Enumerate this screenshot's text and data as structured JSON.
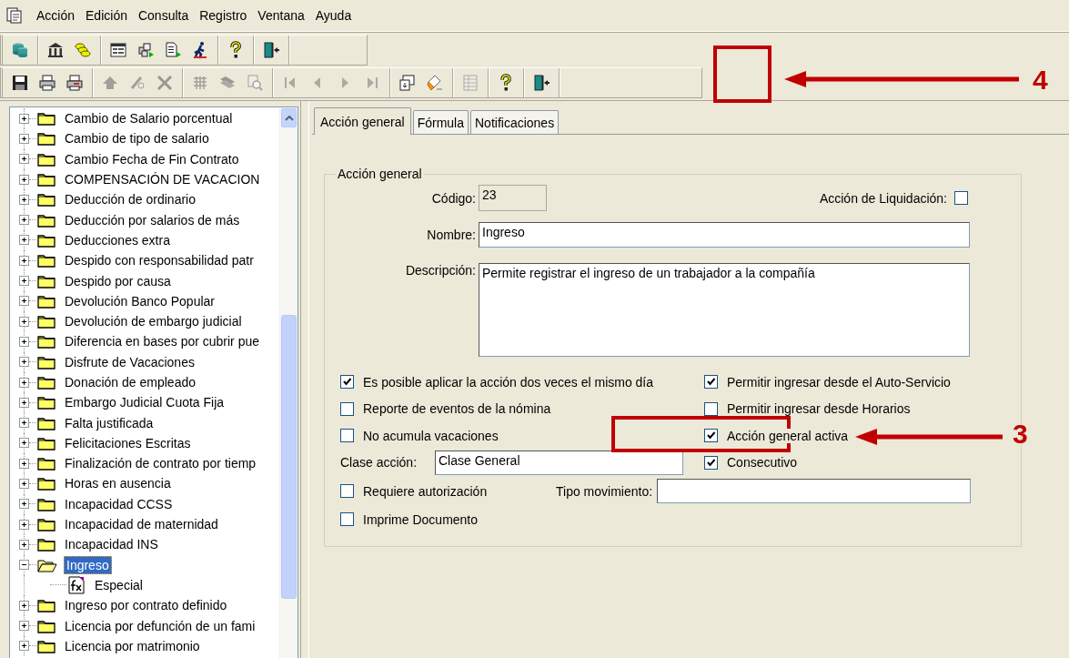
{
  "menu": [
    "Acción",
    "Edición",
    "Consulta",
    "Registro",
    "Ventana",
    "Ayuda"
  ],
  "toolbars": [
    {
      "groups": [
        {
          "buttons": [
            {
              "disabled": false
            }
          ]
        },
        {
          "buttons": [
            {
              "disabled": false
            },
            {
              "disabled": false
            }
          ]
        },
        {
          "buttons": [
            {
              "disabled": false
            },
            {
              "disabled": false
            },
            {
              "disabled": false
            },
            {
              "disabled": false
            }
          ]
        },
        {
          "buttons": [
            {
              "disabled": false
            }
          ]
        },
        {
          "buttons": [
            {
              "disabled": false
            }
          ]
        }
      ]
    },
    {
      "groups": [
        {
          "buttons": [
            {
              "disabled": false
            },
            {
              "disabled": false
            },
            {
              "disabled": false
            }
          ]
        },
        {
          "buttons": [
            {
              "disabled": true
            },
            {
              "disabled": true
            },
            {
              "disabled": true
            }
          ]
        },
        {
          "buttons": [
            {
              "disabled": true
            },
            {
              "disabled": true
            },
            {
              "disabled": true
            }
          ]
        },
        {
          "buttons": [
            {
              "disabled": true
            },
            {
              "disabled": true
            },
            {
              "disabled": true
            },
            {
              "disabled": true
            }
          ]
        },
        {
          "buttons": [
            {
              "disabled": false
            },
            {
              "disabled": false
            }
          ]
        },
        {
          "buttons": [
            {
              "disabled": true
            }
          ]
        },
        {
          "buttons": [
            {
              "disabled": false
            }
          ]
        },
        {
          "buttons": [
            {
              "disabled": false
            }
          ]
        }
      ]
    }
  ],
  "tree": [
    {
      "label": "Cambio de Salario porcentual",
      "expanded": false,
      "selected": false
    },
    {
      "label": "Cambio de tipo de salario",
      "expanded": false,
      "selected": false
    },
    {
      "label": "Cambio Fecha de Fin Contrato",
      "expanded": false,
      "selected": false
    },
    {
      "label": "COMPENSACIÓN DE VACACION",
      "expanded": false,
      "selected": false
    },
    {
      "label": "Deducción de ordinario",
      "expanded": false,
      "selected": false
    },
    {
      "label": "Deducción por salarios de más",
      "expanded": false,
      "selected": false
    },
    {
      "label": "Deducciones extra",
      "expanded": false,
      "selected": false
    },
    {
      "label": "Despido con responsabilidad patr",
      "expanded": false,
      "selected": false
    },
    {
      "label": "Despido por causa",
      "expanded": false,
      "selected": false
    },
    {
      "label": "Devolución Banco Popular",
      "expanded": false,
      "selected": false
    },
    {
      "label": "Devolución de embargo judicial",
      "expanded": false,
      "selected": false
    },
    {
      "label": "Diferencia en bases por cubrir pue",
      "expanded": false,
      "selected": false
    },
    {
      "label": "Disfrute de Vacaciones",
      "expanded": false,
      "selected": false
    },
    {
      "label": "Donación de empleado",
      "expanded": false,
      "selected": false
    },
    {
      "label": "Embargo Judicial Cuota Fija",
      "expanded": false,
      "selected": false
    },
    {
      "label": "Falta justificada",
      "expanded": false,
      "selected": false
    },
    {
      "label": "Felicitaciones Escritas",
      "expanded": false,
      "selected": false
    },
    {
      "label": "Finalización de contrato por tiemp",
      "expanded": false,
      "selected": false
    },
    {
      "label": "Horas en ausencia",
      "expanded": false,
      "selected": false
    },
    {
      "label": "Incapacidad CCSS",
      "expanded": false,
      "selected": false
    },
    {
      "label": "Incapacidad de maternidad",
      "expanded": false,
      "selected": false
    },
    {
      "label": "Incapacidad INS",
      "expanded": false,
      "selected": false
    },
    {
      "label": "Ingreso",
      "expanded": true,
      "selected": true,
      "children": [
        {
          "label": "Especial",
          "selected": false
        }
      ]
    },
    {
      "label": "Ingreso por contrato definido",
      "expanded": false,
      "selected": false
    },
    {
      "label": "Licencia por defunción de un fami",
      "expanded": false,
      "selected": false
    },
    {
      "label": "Licencia por matrimonio",
      "expanded": false,
      "selected": false
    }
  ],
  "tabs": [
    {
      "label": "Acción general",
      "selected": true
    },
    {
      "label": "Fórmula",
      "selected": false
    },
    {
      "label": "Notificaciones",
      "selected": false
    }
  ],
  "group_title": "Acción general",
  "codigo": {
    "label": "Código:",
    "value": "23"
  },
  "liquidacion": {
    "label": "Acción de Liquidación:",
    "checked": false
  },
  "nombre": {
    "label": "Nombre:",
    "value": "Ingreso"
  },
  "descripcion": {
    "label": "Descripción:",
    "value": "Permite registrar el ingreso de un trabajador a la compañía"
  },
  "options_left": [
    {
      "label": "Es posible aplicar la acción dos veces el mismo día",
      "checked": true
    },
    {
      "label": "Reporte de eventos de la nómina",
      "checked": false
    },
    {
      "label": "No acumula vacaciones",
      "checked": false
    },
    {
      "label": "Requiere autorización",
      "checked": false
    },
    {
      "label": "Imprime Documento",
      "checked": false
    }
  ],
  "options_right": [
    {
      "label": "Permitir ingresar desde el Auto-Servicio",
      "checked": true
    },
    {
      "label": "Permitir ingresar desde Horarios",
      "checked": false
    },
    {
      "label": "Acción general activa",
      "checked": true
    },
    {
      "label": "Consecutivo",
      "checked": true
    }
  ],
  "clase": {
    "label": "Clase acción:",
    "value": "Clase General"
  },
  "tipo": {
    "label": "Tipo movimiento:"
  },
  "callouts": [
    {
      "label": "4"
    },
    {
      "label": "3"
    }
  ]
}
